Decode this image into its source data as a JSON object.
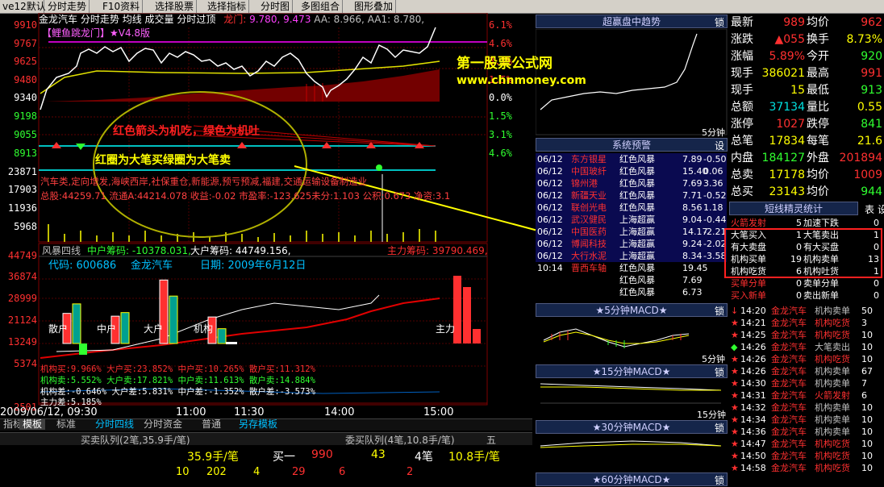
{
  "toolbar": {
    "version": "ve12默认",
    "items": [
      "分时走势",
      "F10资料",
      "选择股票",
      "选择指标",
      "分时图",
      "多图组合",
      "图形叠加"
    ]
  },
  "chart_header": {
    "stock": "金龙汽车",
    "mode": "分时走势",
    "l1": "均线",
    "l2": "成交量",
    "l3": "分时过顶",
    "dragon": "龙门:",
    "v1": "9.780,",
    "v2": "9.473",
    "aa": "AA: 8.966,",
    "aa1": "AA1: 8.780,",
    "formula": "【鲤鱼跳龙门】★V4.8版"
  },
  "price_axis": [
    "9910",
    "9767",
    "9625",
    "9480",
    "9340",
    "9198",
    "9055",
    "8913",
    "23871",
    "17903",
    "11936",
    "5968"
  ],
  "pct_axis": [
    {
      "text": "6.1%",
      "color": "#ff3030"
    },
    {
      "text": "4.6%",
      "color": "#ff3030"
    },
    {
      "text": "3.1%",
      "color": "#ff3030"
    },
    {
      "text": "1.5%",
      "color": "#ff3030"
    },
    {
      "text": "0.0%",
      "color": "#ffffff"
    },
    {
      "text": "1.5%",
      "color": "#30ff30"
    },
    {
      "text": "3.1%",
      "color": "#30ff30"
    },
    {
      "text": "4.6%",
      "color": "#30ff30"
    }
  ],
  "annotations": {
    "red_text": "红色箭头为机吃，绿色为机吐",
    "yellow_text": "红圈为大笔买绿圈为大笔卖",
    "site_name": "第一股票公式网",
    "site_url": "www.chnmoney.com"
  },
  "info_lines": {
    "line1": "汽车类,定向增发,海峡西岸,社保重仓,新能源,预亏预减,福建,交通运输设备制造业",
    "line2": "总股:44259.71 流通A:44214.078 收益:-0.02 市盈率:-123.625未分:1.103 公积:0.673 净资:3.1"
  },
  "lower_panel": {
    "title": "风暴四线",
    "chip_main": "中户筹码: -10378.031,",
    "chip_large": "大户筹码: 44749.156,",
    "chip_force": "主力筹码: 39790.469,",
    "code_label": "代码: 600686",
    "name": "金龙汽车",
    "date_label": "日期: 2009年6月12日",
    "axis": [
      "44749",
      "36874",
      "28999",
      "21124",
      "13249",
      "5374",
      "-2501"
    ],
    "groups": [
      "散户",
      "中户",
      "大户",
      "机构",
      "主力"
    ],
    "stats1": "机构买:9.966% 大户买:23.852% 中户买:10.265% 散户买:11.312%",
    "stats2": "机构卖:5.552% 大户卖:17.821% 中户卖:11.613% 散户卖:14.884%",
    "stats3": "机构差:-0.646% 大户差:5.831% 中户差:-1.352% 散户差:-3.573%",
    "stats4": "主力差:5.185%"
  },
  "chart_data": {
    "type": "bar",
    "categories": [
      "散户",
      "中户",
      "大户",
      "机构",
      "主力"
    ],
    "series": [
      {
        "name": "买",
        "values": [
          11.312,
          10.265,
          23.852,
          9.966,
          null
        ]
      },
      {
        "name": "卖",
        "values": [
          14.884,
          11.613,
          17.821,
          5.552,
          null
        ]
      }
    ]
  },
  "time_axis": [
    "2009/06/12, 09:30",
    "11:00",
    "11:30",
    "14:00",
    "15:00"
  ],
  "bottom_tabs": [
    "指标",
    "模板",
    "标准",
    "分时四线",
    "分时资金",
    "普通",
    "另存模板"
  ],
  "bottom_strip": {
    "left_title": "买卖队列(2笔,35.9手/笔)",
    "mid_title": "委买队列(4笔,10.8手/笔)",
    "wu": "五",
    "r2_a": "35.9手/笔",
    "r2_b": "买一",
    "r2_c": "990",
    "r2_d": "43",
    "r2_e": "4笔",
    "r2_f": "10.8手/笔",
    "r3_a": "10",
    "r3_b": "202",
    "r3_c": "4",
    "r3_d": "29",
    "r3_e": "6",
    "r3_f": "2"
  },
  "right_mid": {
    "super_title": "超赢盘中趋势",
    "lock": "锁",
    "five_min": "5分钟",
    "alert_title": "系统预警",
    "set": "设",
    "alerts": [
      [
        "06/12",
        "东方银星",
        "红色风暴",
        "7.89",
        "-0.50"
      ],
      [
        "06/12",
        "中国玻纤",
        "红色风暴",
        "15.40",
        "0.06"
      ],
      [
        "06/12",
        "锦州港",
        "红色风暴",
        "7.69",
        "3.36"
      ],
      [
        "06/12",
        "新疆天业",
        "红色风暴",
        "7.71",
        "-0.52"
      ],
      [
        "06/12",
        "联创光电",
        "红色风暴",
        "8.56",
        "1.18"
      ],
      [
        "06/12",
        "武汉健民",
        "上海超赢",
        "9.04",
        "-0.44"
      ],
      [
        "06/12",
        "中国医药",
        "上海超赢",
        "14.17",
        "-2.21"
      ],
      [
        "06/12",
        "博闻科技",
        "上海超赢",
        "9.24",
        "-2.02"
      ],
      [
        "06/12",
        "大行水泥",
        "上海超赢",
        "8.34",
        "-3.58"
      ],
      [
        "10:14",
        "晋西车轴",
        "红色风暴",
        "19.45",
        ""
      ],
      [
        "",
        "",
        "红色风暴",
        "7.69",
        ""
      ],
      [
        "",
        "",
        "红色风暴",
        "6.73",
        ""
      ]
    ],
    "macd5": "★5分钟MACD★",
    "macd15": "★15分钟MACD★",
    "macd30": "★30分钟MACD★",
    "macd60": "★60分钟MACD★",
    "l5": "5分钟",
    "l15": "15分钟"
  },
  "quote": [
    {
      "l1": "最新",
      "v1": "989",
      "c1": "#ff3030",
      "l2": "均价",
      "v2": "962",
      "c2": "#ff3030"
    },
    {
      "l1": "涨跌",
      "v1": "▲055",
      "c1": "#ff3030",
      "l2": "换手",
      "v2": "8.73%",
      "c2": "#ffff00"
    },
    {
      "l1": "涨幅",
      "v1": "5.89%",
      "c1": "#ff3030",
      "l2": "今开",
      "v2": "920",
      "c2": "#30ff30"
    },
    {
      "l1": "现手",
      "v1": "386021",
      "c1": "#ffff00",
      "l2": "最高",
      "v2": "991",
      "c2": "#ff3030"
    },
    {
      "l1": "现手",
      "v1": "15",
      "c1": "#ffff00",
      "l2": "最低",
      "v2": "913",
      "c2": "#30ff30"
    },
    {
      "l1": "总额",
      "v1": "37134",
      "c1": "#00e0e0",
      "l2": "量比",
      "v2": "0.55",
      "c2": "#ffff00"
    },
    {
      "l1": "涨停",
      "v1": "1027",
      "c1": "#ff3030",
      "l2": "跌停",
      "v2": "841",
      "c2": "#30ff30"
    },
    {
      "l1": "总笔",
      "v1": "17834",
      "c1": "#ffff00",
      "l2": "每笔",
      "v2": "21.6",
      "c2": "#ffff00"
    },
    {
      "l1": "内盘",
      "v1": "184127",
      "c1": "#30ff30",
      "l2": "外盘",
      "v2": "201894",
      "c2": "#ff3030"
    },
    {
      "l1": "总卖",
      "v1": "17178",
      "c1": "#ffff00",
      "l2": "均价",
      "v2": "1009",
      "c2": "#ff3030"
    },
    {
      "l1": "总买",
      "v1": "23143",
      "c1": "#ffff00",
      "l2": "均价",
      "v2": "944",
      "c2": "#30ff30"
    }
  ],
  "short_stats": {
    "title": "短线精灵统计",
    "tab_a": "表",
    "tab_b": "设",
    "rows": [
      [
        "火箭发射",
        "5",
        "加速下跌",
        "0"
      ],
      [
        "大笔买入",
        "1",
        "大笔卖出",
        "1"
      ],
      [
        "有大卖盘",
        "0",
        "有大买盘",
        "0"
      ],
      [
        "机构买单",
        "19",
        "机构卖单",
        "13"
      ],
      [
        "机构吃货",
        "6",
        "机构吐货",
        "1"
      ],
      [
        "买单分单",
        "0",
        "卖单分单",
        "0"
      ],
      [
        "买入新单",
        "0",
        "卖出新单",
        "0"
      ]
    ]
  },
  "trades": [
    [
      "↓",
      "14:20",
      "金龙汽车",
      "机构卖单",
      "50"
    ],
    [
      "★",
      "14:21",
      "金龙汽车",
      "机构吃货",
      "3"
    ],
    [
      "★",
      "14:25",
      "金龙汽车",
      "机构吃货",
      "10"
    ],
    [
      "◆",
      "14:26",
      "金龙汽车",
      "大笔卖出",
      "10"
    ],
    [
      "★",
      "14:26",
      "金龙汽车",
      "机构吃货",
      "10"
    ],
    [
      "★",
      "14:26",
      "金龙汽车",
      "机构卖单",
      "67"
    ],
    [
      "★",
      "14:30",
      "金龙汽车",
      "机构卖单",
      "7"
    ],
    [
      "★",
      "14:31",
      "金龙汽车",
      "火箭发射",
      "6"
    ],
    [
      "★",
      "14:32",
      "金龙汽车",
      "机构卖单",
      "10"
    ],
    [
      "★",
      "14:34",
      "金龙汽车",
      "机构卖单",
      "10"
    ],
    [
      "★",
      "14:36",
      "金龙汽车",
      "机构卖单",
      "10"
    ],
    [
      "★",
      "14:47",
      "金龙汽车",
      "机构吃货",
      "10"
    ],
    [
      "★",
      "14:50",
      "金龙汽车",
      "机构吃货",
      "10"
    ],
    [
      "★",
      "14:58",
      "金龙汽车",
      "机构吃货",
      "10"
    ]
  ]
}
